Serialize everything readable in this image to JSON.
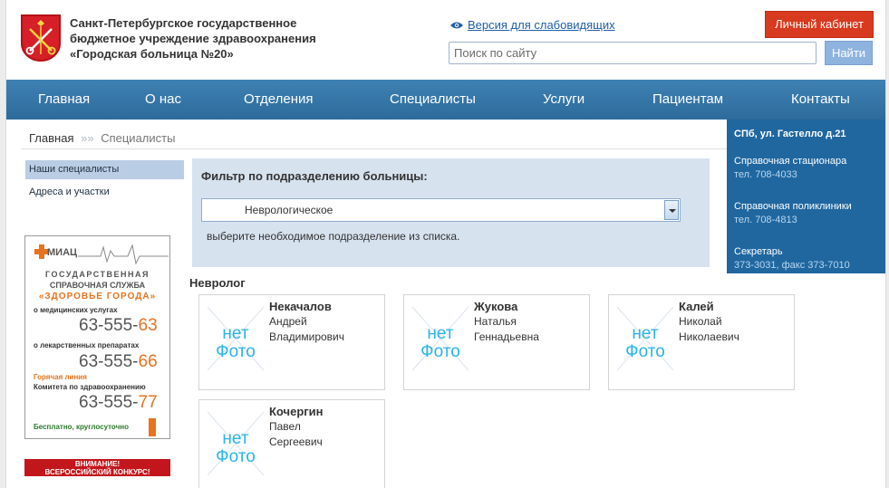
{
  "header": {
    "org_line1": "Санкт-Петербургское государственное",
    "org_line2": "бюджетное учреждение здравоохранения",
    "org_line3": "«Городская больница №20»",
    "low_vision_link": "Версия для слабовидящих",
    "cabinet_button": "Личный кабинет",
    "search_placeholder": "Поиск по сайту",
    "search_button": "Найти"
  },
  "nav": {
    "items": [
      "Главная",
      "О нас",
      "Отделения",
      "Специалисты",
      "Услуги",
      "Пациентам",
      "Контакты"
    ]
  },
  "breadcrumb": {
    "home": "Главная",
    "separator": "»»",
    "current": "Специалисты"
  },
  "sidebar": {
    "items": [
      "Наши специалисты",
      "Адреса и участки"
    ]
  },
  "infobox": {
    "address": "СПб, ул. Гастелло д.21",
    "hospital_label": "Справочная стационара",
    "hospital_tel": "тел. 708-4033",
    "clinic_label": "Справочная поликлиники",
    "clinic_tel": "тел. 708-4813",
    "secretary_label": "Секретарь",
    "secretary_tel": "373-3031, факс 373-7010"
  },
  "ad": {
    "logo": "МИАЦ",
    "title1": "ГОСУДАРСТВЕННАЯ",
    "title2": "СПРАВОЧНАЯ СЛУЖБА",
    "title3": "«ЗДОРОВЬЕ ГОРОДА»",
    "label1": "о медицинских услугах",
    "phone1_main": "63-555-",
    "phone1_acc": "63",
    "label2": "о лекарственных препаратах",
    "phone2_main": "63-555-",
    "phone2_acc": "66",
    "hotline": "Горячая линия",
    "label3": "Комитета по здравоохранению",
    "phone3_main": "63-555-",
    "phone3_acc": "77",
    "free": "Бесплатно, круглосуточно",
    "banner2_line1": "ВНИМАНИЕ!",
    "banner2_line2": "ВСЕРОССИЙСКИЙ КОНКУРС!"
  },
  "filter": {
    "title": "Фильтр по подразделению больницы:",
    "selected": "Неврологическое",
    "hint": "выберите необходимое подразделение из списка."
  },
  "section": {
    "title": "Невролог"
  },
  "nophoto": {
    "line1": "нет",
    "line2": "Фото"
  },
  "doctors": [
    {
      "last": "Некачалов",
      "first": "Андрей",
      "middle": "Владимирович"
    },
    {
      "last": "Жукова",
      "first": "Наталья",
      "middle": "Геннадьевна"
    },
    {
      "last": "Калей",
      "first": "Николай",
      "middle": "Николаевич"
    },
    {
      "last": "Кочергин",
      "first": "Павел",
      "middle": "Сергеевич"
    }
  ],
  "colors": {
    "nav": "#2d6b9c",
    "infobox": "#2067a0",
    "cabinet": "#d83a1f",
    "accent_orange": "#e8731e",
    "nophoto": "#29b4e8"
  }
}
